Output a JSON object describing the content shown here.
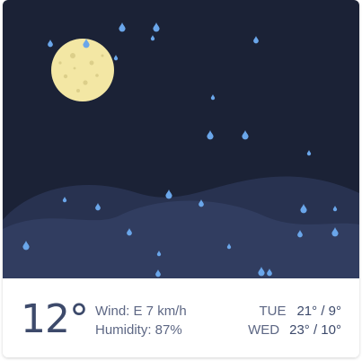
{
  "scene": {
    "sky_color": "#1b2236",
    "hill_back_color": "#283250",
    "hill_front_color": "#313d60",
    "moon_color": "#f3e7a4",
    "moon_crater_color": "#dccf8a",
    "rain_color": "#6aa6ea",
    "weather_icon": "moon-rain-icon"
  },
  "current": {
    "temperature": "12°",
    "wind": "Wind: E 7 km/h",
    "humidity": "Humidity: 87%"
  },
  "forecast": [
    {
      "day": "TUE",
      "temps": "21° / 9°"
    },
    {
      "day": "WED",
      "temps": "23° / 10°"
    }
  ],
  "colors": {
    "text_primary": "#3d4a6b",
    "text_secondary": "#5d6784"
  }
}
